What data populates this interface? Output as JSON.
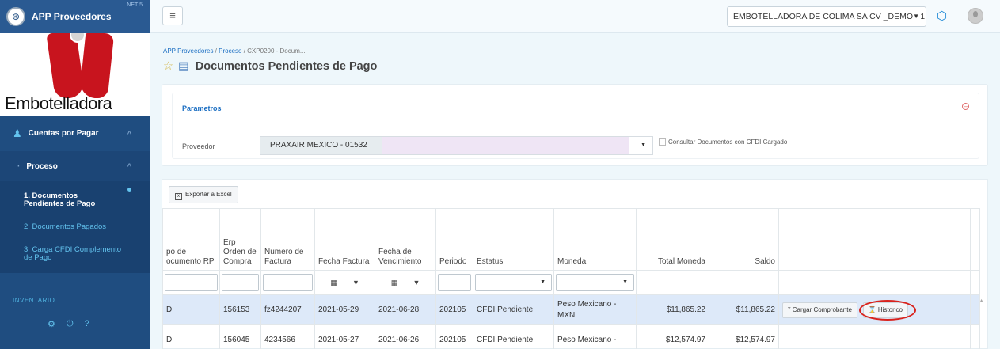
{
  "sidebar": {
    "app_name": "APP Proveedores",
    "version": ".NET 5",
    "logo_word": "Embotelladora",
    "section": {
      "label": "Cuentas por Pagar",
      "icon": "people-icon"
    },
    "subsection": {
      "label": "Proceso"
    },
    "items": [
      {
        "label": "1. Documentos Pendientes de Pago",
        "active": true
      },
      {
        "label": "2. Documentos Pagados",
        "active": false
      },
      {
        "label": "3. Carga CFDI Complemento de Pago",
        "active": false
      }
    ],
    "inventory_label": "INVENTARIO",
    "bottom_icons": [
      "settings-icon",
      "power-icon",
      "help-icon"
    ]
  },
  "topbar": {
    "company": "EMBOTELLADORA DE COLIMA SA CV _DEMO - 1"
  },
  "breadcrumb": {
    "root": "APP Proveedores",
    "sep1": " / ",
    "mid": "Proceso",
    "sep2": " / ",
    "current": "CXP0200 - Docum..."
  },
  "page_title": "Documentos Pendientes de Pago",
  "params": {
    "title": "Parametros",
    "proveedor_label": "Proveedor",
    "proveedor_value": "PRAXAIR MEXICO - 01532",
    "checkbox_label": "Consultar Documentos con CFDI Cargado",
    "checkbox_checked": false
  },
  "table": {
    "export_label": "Exportar a Excel",
    "headers": {
      "tipo": "po de ocumento RP",
      "orden": "Erp Orden de Compra",
      "factura": "Numero de Factura",
      "fecha": "Fecha Factura",
      "vence": "Fecha de Vencimiento",
      "periodo": "Periodo",
      "estatus": "Estatus",
      "moneda": "Moneda",
      "total": "Total Moneda",
      "saldo": "Saldo"
    },
    "rows": [
      {
        "tipo": "D",
        "orden": "156153",
        "factura": "fz4244207",
        "fecha": "2021-05-29",
        "vence": "2021-06-28",
        "periodo": "202105",
        "estatus": "CFDI Pendiente",
        "moneda": "Peso Mexicano - MXN",
        "total": "$11,865.22",
        "saldo": "$11,865.22",
        "btn_cargar": "Cargar Comprobante",
        "btn_historico": "Historico"
      },
      {
        "tipo": "D",
        "orden": "156045",
        "factura": "4234566",
        "fecha": "2021-05-27",
        "vence": "2021-06-26",
        "periodo": "202105",
        "estatus": "CFDI Pendiente",
        "moneda": "Peso Mexicano -",
        "total": "$12,574.97",
        "saldo": "$12,574.97"
      }
    ]
  }
}
